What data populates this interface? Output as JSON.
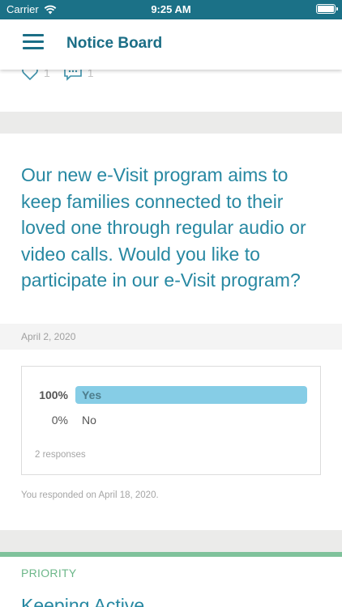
{
  "status_bar": {
    "carrier": "Carrier",
    "time": "9:25 AM"
  },
  "nav": {
    "title": "Notice Board"
  },
  "previous_post": {
    "likes": "1",
    "comments": "1"
  },
  "post": {
    "question": "Our new e-Visit program aims to keep families connected to their loved one through regular audio or video calls. Would you like to participate in our e-Visit program?",
    "date": "April 2, 2020",
    "poll": {
      "options": [
        {
          "percent": "100%",
          "label": "Yes",
          "share": 1.0
        },
        {
          "percent": "0%",
          "label": "No",
          "share": 0.0
        }
      ],
      "responses": "2 responses"
    },
    "responded_text": "You responded on April 18, 2020."
  },
  "next_post": {
    "tag": "PRIORITY",
    "title": "Keeping Active"
  },
  "colors": {
    "accent": "#1b6e86",
    "text_teal": "#2788a2",
    "poll_bar": "#86cde6",
    "priority": "#6cb789"
  }
}
